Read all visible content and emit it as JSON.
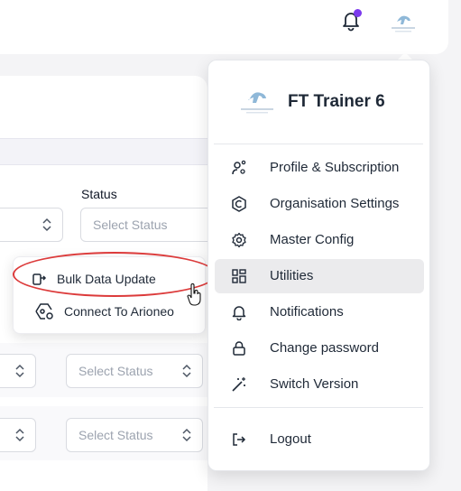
{
  "header": {
    "notification_dot_color": "#7c3aed",
    "avatar_icon": "horse-logo-icon"
  },
  "form": {
    "status_label": "Status",
    "status_placeholder": "Select Status",
    "row_selects": [
      "Select Status",
      "Select Status"
    ]
  },
  "popup": {
    "items": [
      {
        "label": "Bulk Data Update",
        "icon": "bulk-update-icon"
      },
      {
        "label": "Connect To Arioneo",
        "icon": "connect-icon"
      }
    ],
    "highlight_color": "#dc3b3b"
  },
  "menu": {
    "title": "FT Trainer 6",
    "logo_icon": "horse-logo-icon",
    "items": [
      {
        "label": "Profile & Subscription",
        "icon": "user-gear-icon"
      },
      {
        "label": "Organisation Settings",
        "icon": "organisation-icon"
      },
      {
        "label": "Master Config",
        "icon": "gear-icon"
      },
      {
        "label": "Utilities",
        "icon": "grid-icon"
      },
      {
        "label": "Notifications",
        "icon": "bell-icon"
      },
      {
        "label": "Change password",
        "icon": "lock-icon"
      },
      {
        "label": "Switch Version",
        "icon": "magic-wand-icon"
      }
    ],
    "logout_label": "Logout",
    "active_item": "Utilities"
  }
}
